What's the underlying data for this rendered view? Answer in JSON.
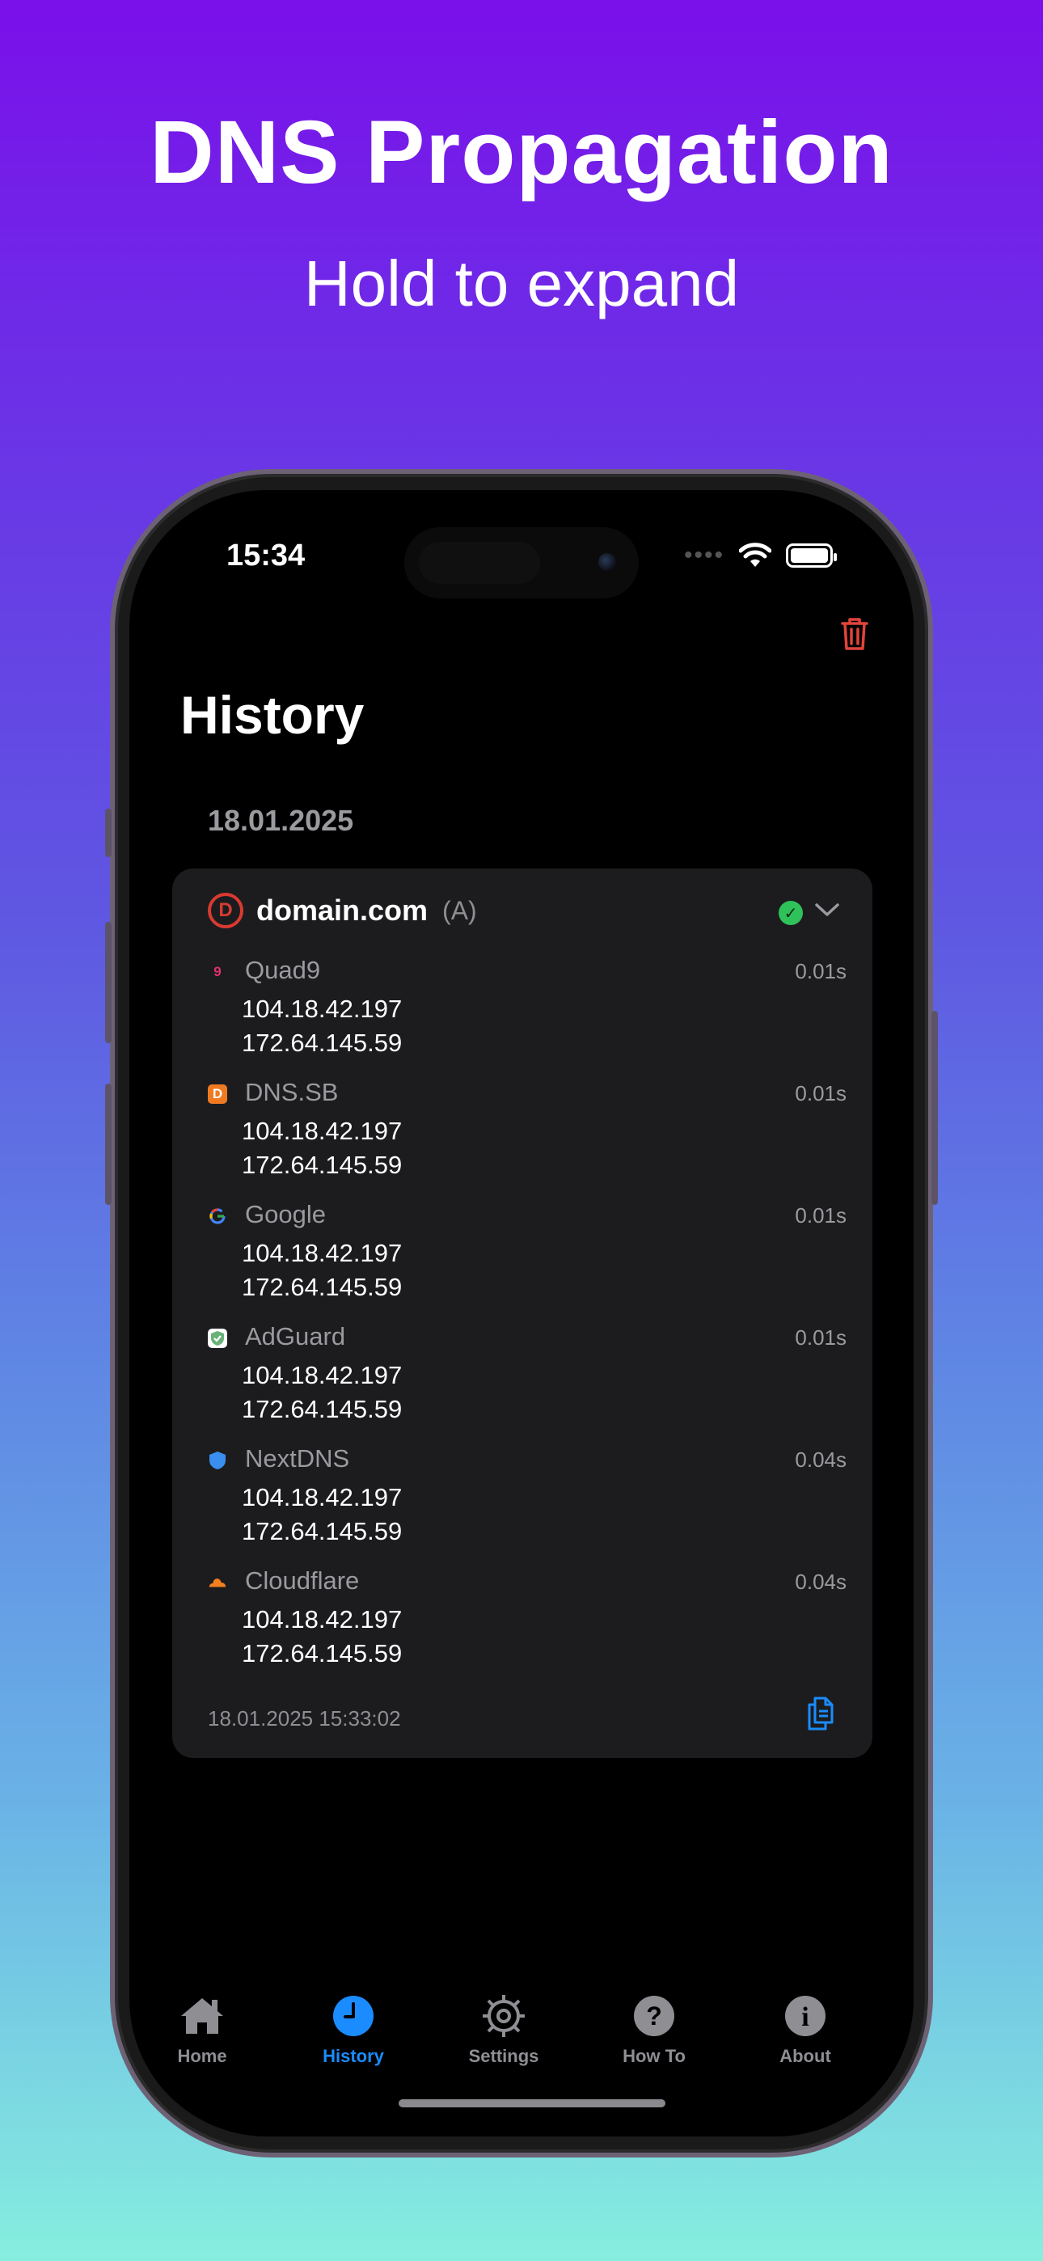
{
  "promo": {
    "title": "DNS Propagation",
    "subtitle": "Hold to expand"
  },
  "status_bar": {
    "time": "15:34",
    "signal": "••••"
  },
  "header": {
    "title": "History",
    "trash_icon": "trash-icon",
    "accent": "#e0443a"
  },
  "section": {
    "date": "18.01.2025"
  },
  "entry": {
    "domain": "domain.com",
    "record_type": "(A)",
    "status": "success",
    "timestamp": "18.01.2025 15:33:02",
    "resolvers": [
      {
        "name": "Quad9",
        "time": "0.01s",
        "ips": [
          "104.18.42.197",
          "172.64.145.59"
        ],
        "icon": "quad9-icon",
        "color": "#e0316b"
      },
      {
        "name": "DNS.SB",
        "time": "0.01s",
        "ips": [
          "104.18.42.197",
          "172.64.145.59"
        ],
        "icon": "dnssb-icon",
        "color": "#f07a22"
      },
      {
        "name": "Google",
        "time": "0.01s",
        "ips": [
          "104.18.42.197",
          "172.64.145.59"
        ],
        "icon": "google-icon",
        "color": "#4285f4"
      },
      {
        "name": "AdGuard",
        "time": "0.01s",
        "ips": [
          "104.18.42.197",
          "172.64.145.59"
        ],
        "icon": "adguard-icon",
        "color": "#67b279"
      },
      {
        "name": "NextDNS",
        "time": "0.04s",
        "ips": [
          "104.18.42.197",
          "172.64.145.59"
        ],
        "icon": "nextdns-icon",
        "color": "#3a8ef0"
      },
      {
        "name": "Cloudflare",
        "time": "0.04s",
        "ips": [
          "104.18.42.197",
          "172.64.145.59"
        ],
        "icon": "cloudflare-icon",
        "color": "#f38020"
      }
    ]
  },
  "tabbar": {
    "active_color": "#1a8cff",
    "inactive_color": "#8e8e93",
    "tabs": [
      {
        "label": "Home",
        "icon": "house-icon",
        "active": false
      },
      {
        "label": "History",
        "icon": "clock-icon",
        "active": true
      },
      {
        "label": "Settings",
        "icon": "gear-icon",
        "active": false
      },
      {
        "label": "How To",
        "icon": "question-icon",
        "active": false
      },
      {
        "label": "About",
        "icon": "info-icon",
        "active": false
      }
    ]
  }
}
